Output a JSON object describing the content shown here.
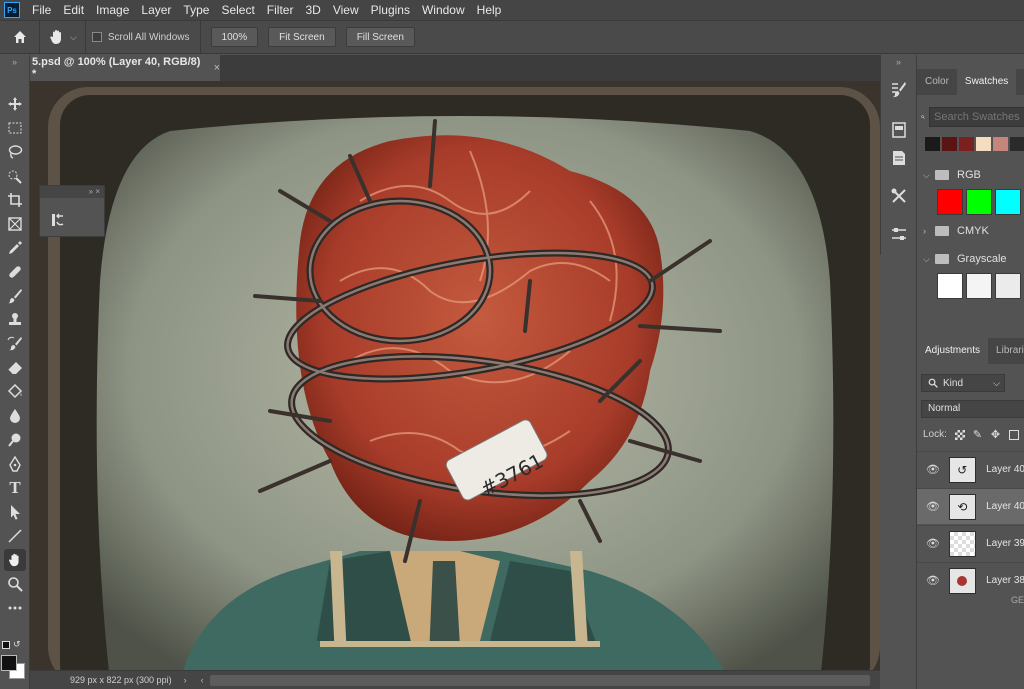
{
  "app": {
    "logo": "Ps"
  },
  "menu": [
    "File",
    "Edit",
    "Image",
    "Layer",
    "Type",
    "Select",
    "Filter",
    "3D",
    "View",
    "Plugins",
    "Window",
    "Help"
  ],
  "options": {
    "scroll_all_label": "Scroll All Windows",
    "zoom_btn": "100%",
    "fit_btn": "Fit Screen",
    "fill_btn": "Fill Screen"
  },
  "document": {
    "tab_title": "5.psd @ 100% (Layer 40, RGB/8) *",
    "close": "×",
    "status": "929 px x 822 px (300 ppi)"
  },
  "tools": [
    "move-tool",
    "marquee-tool",
    "lasso-tool",
    "quick-select-tool",
    "crop-tool",
    "frame-tool",
    "eyedropper-tool",
    "healing-tool",
    "brush-tool",
    "stamp-tool",
    "history-brush-tool",
    "eraser-tool",
    "paint-bucket-tool",
    "blur-tool",
    "dodge-tool",
    "pen-tool",
    "type-tool",
    "path-select-tool",
    "line-tool",
    "hand-tool",
    "zoom-tool",
    "more-tools"
  ],
  "type_tool_glyph": "T",
  "color_panel": {
    "tabs": [
      "Color",
      "Swatches"
    ],
    "active_tab": "Swatches",
    "search_placeholder": "Search Swatches",
    "recent_colors": [
      "#1a1a1a",
      "#5a1414",
      "#7a2020",
      "#f4dcc0",
      "#c4857a",
      "#2a2a2a"
    ],
    "groups": [
      {
        "name": "RGB",
        "expanded": true,
        "swatches": [
          "#ff0000",
          "#00ff00",
          "#00ffff"
        ]
      },
      {
        "name": "CMYK",
        "expanded": false
      },
      {
        "name": "Grayscale",
        "expanded": true,
        "swatches": [
          "#ffffff",
          "#f4f4f4",
          "#ebebeb"
        ]
      }
    ]
  },
  "adjustments_panel": {
    "tabs": [
      "Adjustments",
      "Libraries"
    ],
    "kind_label": "Kind",
    "blend_mode": "Normal",
    "lock_label": "Lock:",
    "layers": [
      {
        "name": "Layer 40",
        "visible": true,
        "selected": false
      },
      {
        "name": "Layer 40",
        "visible": true,
        "selected": true
      },
      {
        "name": "Layer 39",
        "visible": true,
        "selected": false
      },
      {
        "name": "Layer 38",
        "visible": true,
        "selected": false
      }
    ],
    "footer_glyph": "GE"
  },
  "colors": {
    "fg": "#111111",
    "bg": "#ffffff"
  },
  "canvas": {
    "tag_text": "#3761"
  }
}
